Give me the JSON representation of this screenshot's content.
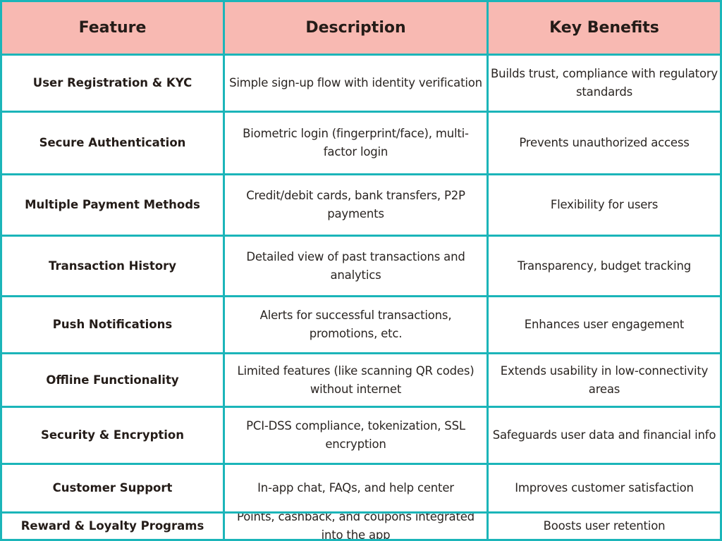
{
  "table": {
    "headers": [
      "Feature",
      "Description",
      "Key Benefits"
    ],
    "rows": [
      {
        "feature": "User Registration & KYC",
        "description": "Simple sign-up flow with identity verification",
        "benefit": "Builds trust, compliance with regulatory standards"
      },
      {
        "feature": "Secure Authentication",
        "description": "Biometric login (fingerprint/face), multi-factor login",
        "benefit": "Prevents unauthorized access"
      },
      {
        "feature": "Multiple Payment Methods",
        "description": "Credit/debit cards, bank transfers, P2P payments",
        "benefit": "Flexibility for users"
      },
      {
        "feature": "Transaction History",
        "description": "Detailed view of past transactions and analytics",
        "benefit": "Transparency, budget tracking"
      },
      {
        "feature": "Push Notifications",
        "description": "Alerts for successful transactions, promotions, etc.",
        "benefit": "Enhances user engagement"
      },
      {
        "feature": "Offline Functionality",
        "description": "Limited features (like scanning QR codes) without internet",
        "benefit": "Extends usability in low-connectivity areas"
      },
      {
        "feature": "Security & Encryption",
        "description": "PCI-DSS compliance, tokenization, SSL encryption",
        "benefit": "Safeguards user data and financial info"
      },
      {
        "feature": "Customer Support",
        "description": "In-app chat, FAQs, and help center",
        "benefit": "Improves customer satisfaction"
      },
      {
        "feature": "Reward & Loyalty Programs",
        "description": "Points, cashback, and coupons integrated into the app",
        "benefit": "Boosts user retention"
      }
    ]
  },
  "colors": {
    "border": "#1bb5b9",
    "header_bg": "#f8b9b2",
    "text": "#2a2522"
  }
}
